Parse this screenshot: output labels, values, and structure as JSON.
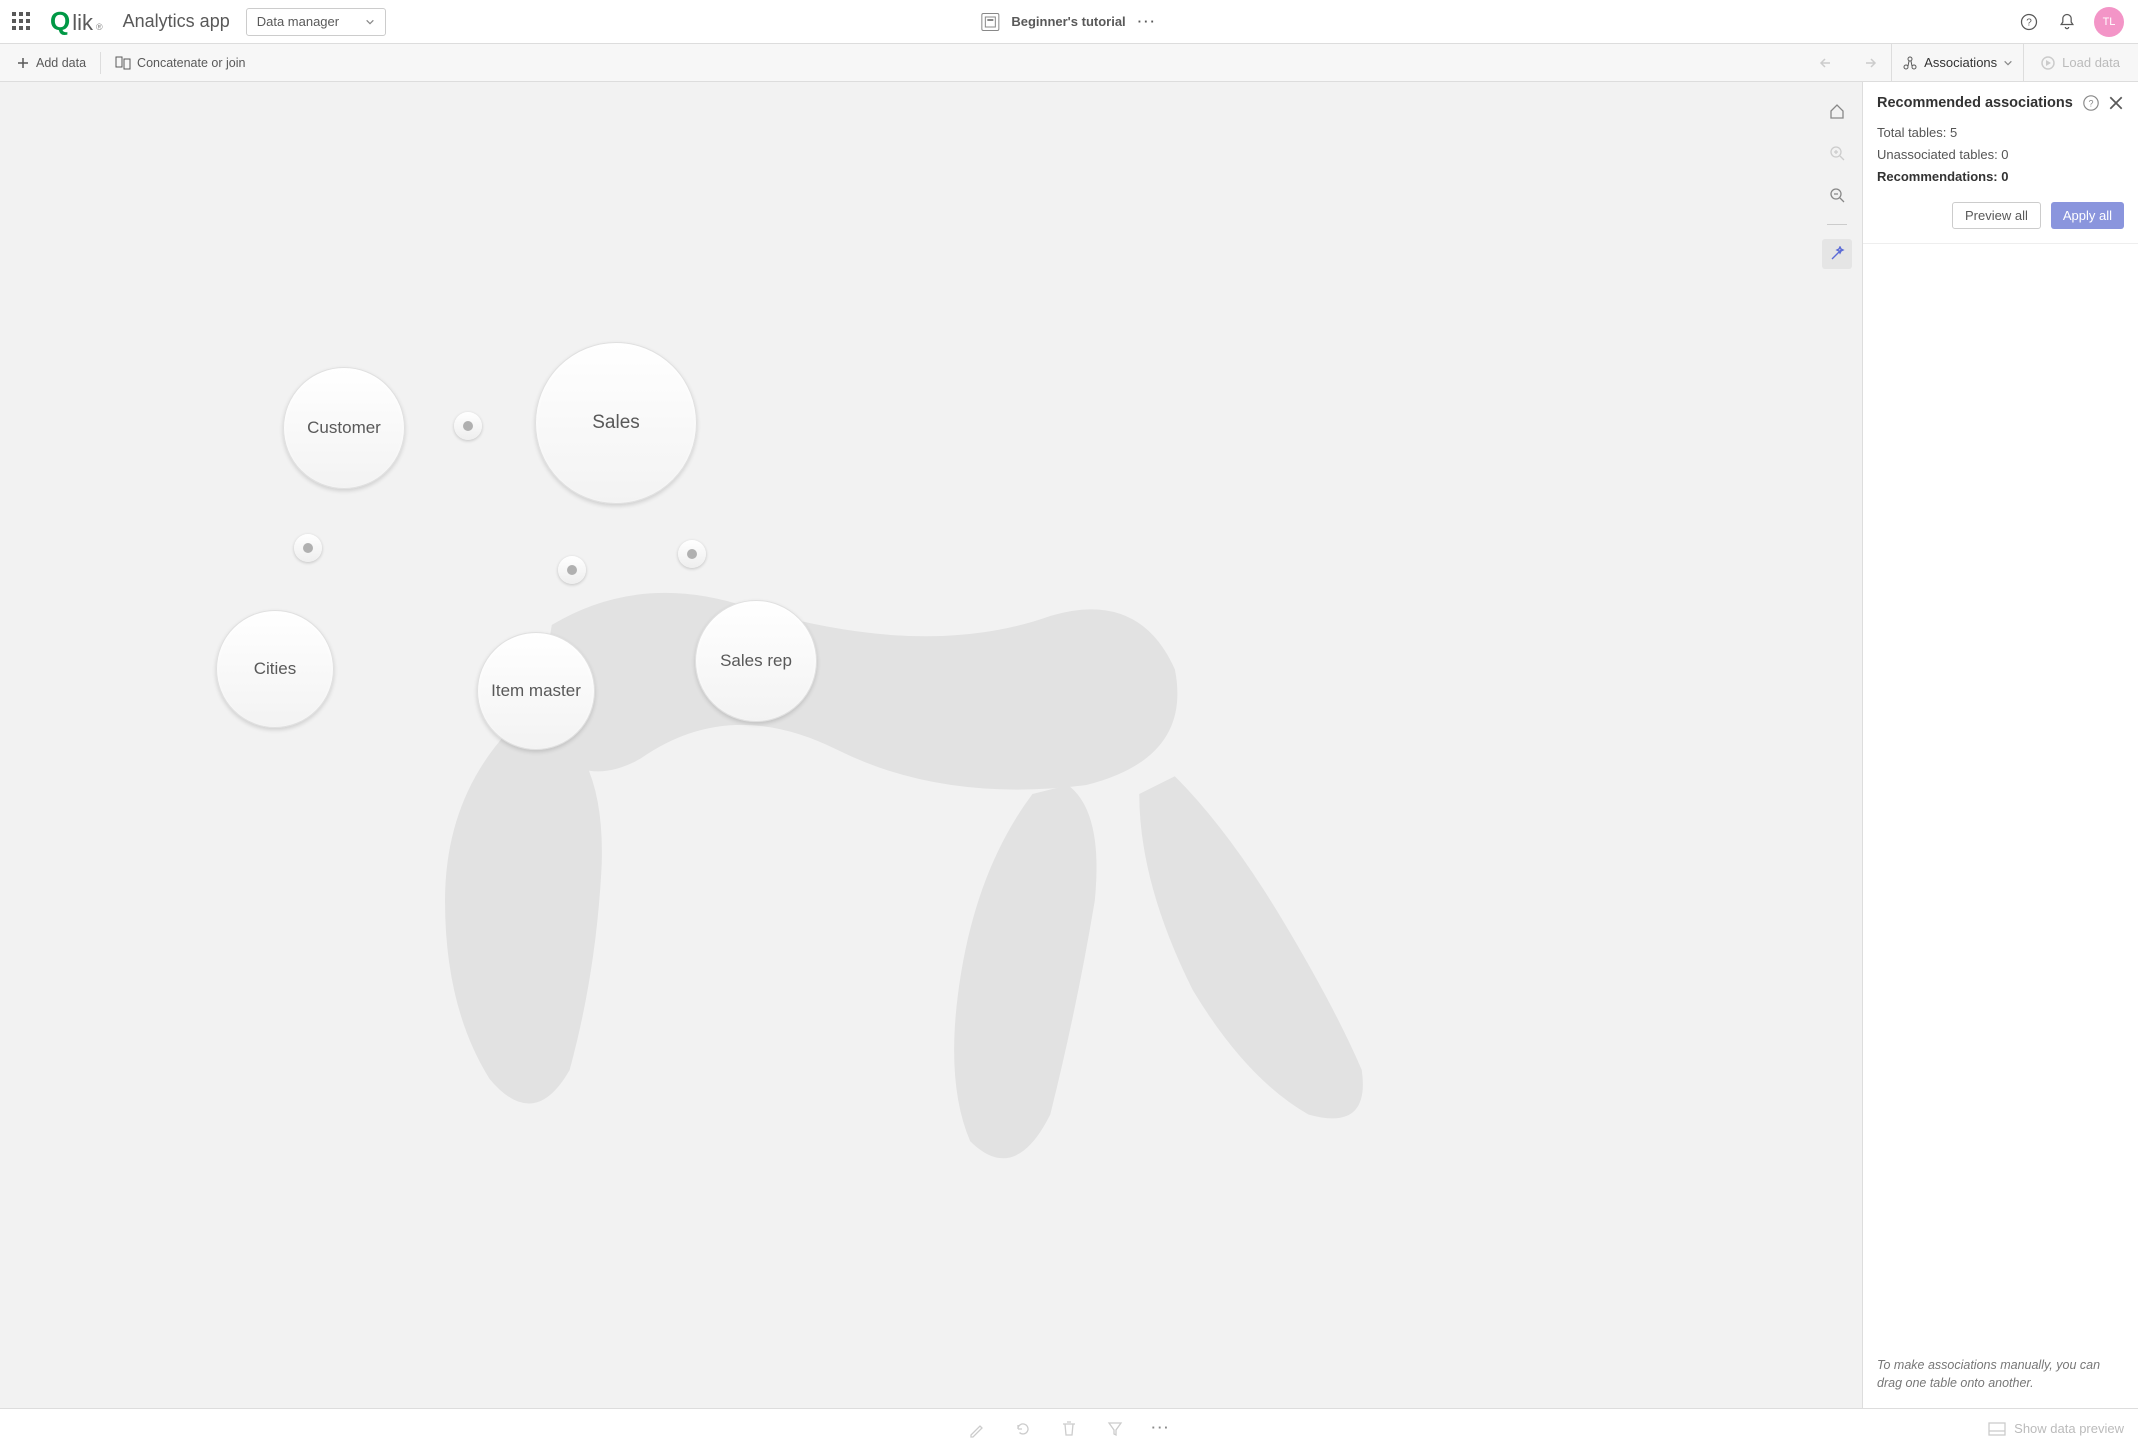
{
  "header": {
    "app_title": "Analytics app",
    "dropdown_label": "Data manager",
    "tutorial_label": "Beginner's tutorial",
    "avatar_initials": "TL"
  },
  "toolbar": {
    "add_data": "Add data",
    "concat_join": "Concatenate or join",
    "associations": "Associations",
    "load_data": "Load data"
  },
  "bubbles": {
    "customer": "Customer",
    "sales": "Sales",
    "cities": "Cities",
    "item_master": "Item master",
    "sales_rep": "Sales rep"
  },
  "panel": {
    "title": "Recommended associations",
    "total_tables_label": "Total tables: ",
    "total_tables_value": "5",
    "unassoc_label": "Unassociated tables: ",
    "unassoc_value": "0",
    "recs_label": "Recommendations: ",
    "recs_value": "0",
    "preview_all": "Preview all",
    "apply_all": "Apply all",
    "hint": "To make associations manually, you can drag one table onto another."
  },
  "bottom": {
    "show_preview": "Show data preview"
  }
}
